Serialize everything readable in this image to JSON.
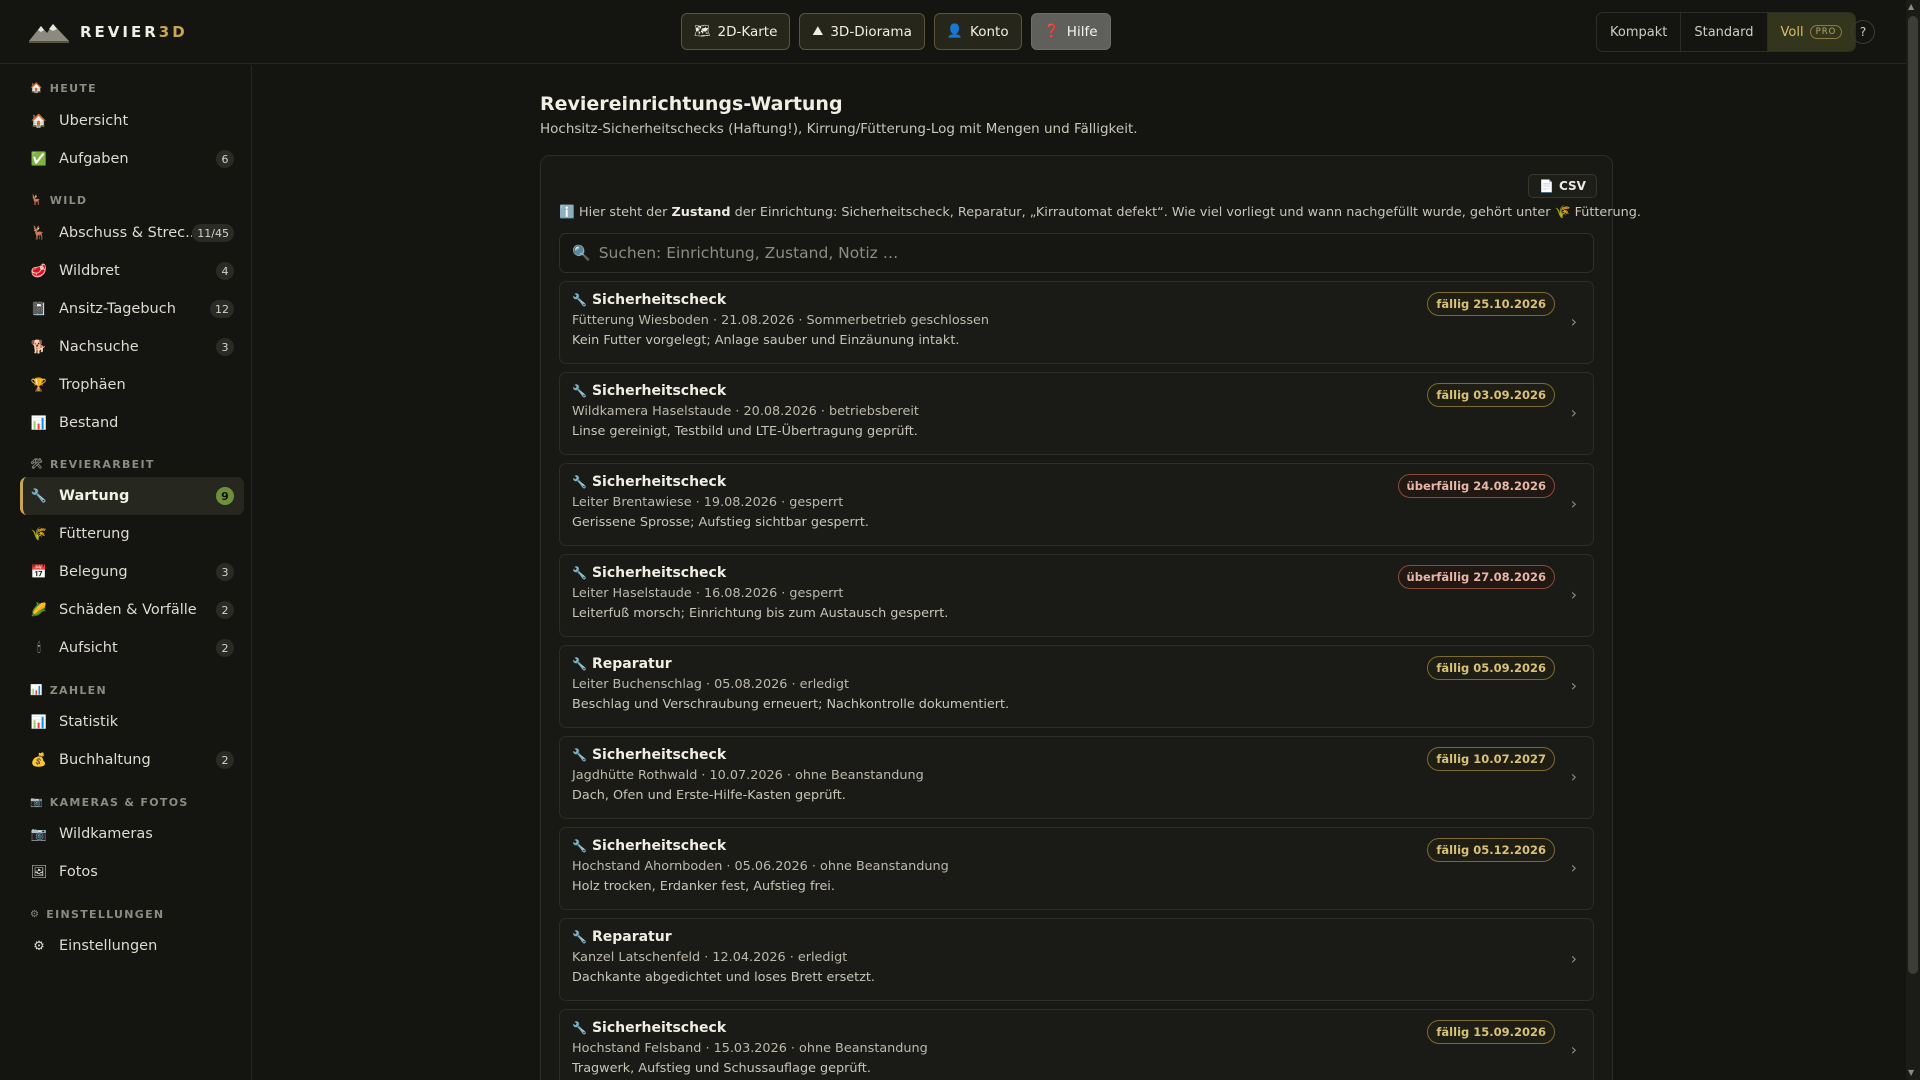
{
  "app": {
    "name_main": "REVIER",
    "name_accent": "3D"
  },
  "nav": {
    "map2d": {
      "icon": "🗺",
      "label": "2D-Karte"
    },
    "diorama3d": {
      "icon": "⛰",
      "label": "3D-Diorama"
    },
    "account": {
      "icon": "👤",
      "label": "Konto"
    },
    "help": {
      "icon": "❓",
      "label": "Hilfe"
    }
  },
  "density": {
    "compact": "Kompakt",
    "standard": "Standard",
    "full": "Voll",
    "pro": "PRO",
    "selected": "Voll"
  },
  "help_short": "?",
  "sidebar": {
    "sections": [
      {
        "icon": "🏠",
        "title": "HEUTE"
      },
      {
        "icon": "🦌",
        "title": "WILD"
      },
      {
        "icon": "🛠",
        "title": "REVIERARBEIT"
      },
      {
        "icon": "📊",
        "title": "ZAHLEN"
      },
      {
        "icon": "📷",
        "title": "KAMERAS & FOTOS"
      },
      {
        "icon": "⚙",
        "title": "EINSTELLUNGEN"
      }
    ],
    "items": [
      {
        "icon": "🏠",
        "label": "Übersicht",
        "badge": ""
      },
      {
        "icon": "✅",
        "label": "Aufgaben",
        "badge": "6"
      },
      {
        "icon": "🦌",
        "label": "Abschuss & Strec...",
        "badge": "11/45"
      },
      {
        "icon": "🥩",
        "label": "Wildbret",
        "badge": "4"
      },
      {
        "icon": "📓",
        "label": "Ansitz-Tagebuch",
        "badge": "12"
      },
      {
        "icon": "🐕",
        "label": "Nachsuche",
        "badge": "3"
      },
      {
        "icon": "🏆",
        "label": "Trophäen",
        "badge": ""
      },
      {
        "icon": "📊",
        "label": "Bestand",
        "badge": ""
      },
      {
        "icon": "🔧",
        "label": "Wartung",
        "badge": "9"
      },
      {
        "icon": "🌾",
        "label": "Fütterung",
        "badge": ""
      },
      {
        "icon": "📅",
        "label": "Belegung",
        "badge": "3"
      },
      {
        "icon": "🌽",
        "label": "Schäden & Vorfälle",
        "badge": "2"
      },
      {
        "icon": "🕯",
        "label": "Aufsicht",
        "badge": "2"
      },
      {
        "icon": "📊",
        "label": "Statistik",
        "badge": ""
      },
      {
        "icon": "💰",
        "label": "Buchhaltung",
        "badge": "2"
      },
      {
        "icon": "📷",
        "label": "Wildkameras",
        "badge": ""
      },
      {
        "icon": "🖼",
        "label": "Fotos",
        "badge": ""
      },
      {
        "icon": "⚙",
        "label": "Einstellungen",
        "badge": ""
      }
    ],
    "active_item": "Wartung"
  },
  "main": {
    "title": "Reviereinrichtungs-Wartung",
    "subtitle": "Hochsitz-Sicherheitschecks (Haftung!), Kirrung/Fütterung-Log mit Mengen und Fälligkeit.",
    "csv_label": "CSV",
    "info": {
      "icon": "ℹ️",
      "pre": "Hier steht der ",
      "bold": "Zustand",
      "post": " der Einrichtung: Sicherheitscheck, Reparatur, „Kirrautomat defekt“. Wie viel vorliegt und wann nachgefüllt wurde, gehört unter 🌾 Fütterung."
    },
    "search_placeholder": "Suchen: Einrichtung, Zustand, Notiz …",
    "entries": [
      {
        "title": "Sicherheitscheck",
        "meta": "Fütterung Wiesboden · 21.08.2026 · Sommerbetrieb geschlossen",
        "note": "Kein Futter vorgelegt; Anlage sauber und Einzäunung intakt.",
        "due": "fällig 25.10.2026",
        "overdue": false
      },
      {
        "title": "Sicherheitscheck",
        "meta": "Wildkamera Haselstaude · 20.08.2026 · betriebsbereit",
        "note": "Linse gereinigt, Testbild und LTE-Übertragung geprüft.",
        "due": "fällig 03.09.2026",
        "overdue": false
      },
      {
        "title": "Sicherheitscheck",
        "meta": "Leiter Brentawiese · 19.08.2026 · gesperrt",
        "note": "Gerissene Sprosse; Aufstieg sichtbar gesperrt.",
        "due": "überfällig 24.08.2026",
        "overdue": true
      },
      {
        "title": "Sicherheitscheck",
        "meta": "Leiter Haselstaude · 16.08.2026 · gesperrt",
        "note": "Leiterfuß morsch; Einrichtung bis zum Austausch gesperrt.",
        "due": "überfällig 27.08.2026",
        "overdue": true
      },
      {
        "title": "Reparatur",
        "meta": "Leiter Buchenschlag · 05.08.2026 · erledigt",
        "note": "Beschlag und Verschraubung erneuert; Nachkontrolle dokumentiert.",
        "due": "fällig 05.09.2026",
        "overdue": false
      },
      {
        "title": "Sicherheitscheck",
        "meta": "Jagdhütte Rothwald · 10.07.2026 · ohne Beanstandung",
        "note": "Dach, Ofen und Erste-Hilfe-Kasten geprüft.",
        "due": "fällig 10.07.2027",
        "overdue": false
      },
      {
        "title": "Sicherheitscheck",
        "meta": "Hochstand Ahornboden · 05.06.2026 · ohne Beanstandung",
        "note": "Holz trocken, Erdanker fest, Aufstieg frei.",
        "due": "fällig 05.12.2026",
        "overdue": false
      },
      {
        "title": "Reparatur",
        "meta": "Kanzel Latschenfeld · 12.04.2026 · erledigt",
        "note": "Dachkante abgedichtet und loses Brett ersetzt.",
        "due": "",
        "overdue": false
      },
      {
        "title": "Sicherheitscheck",
        "meta": "Hochstand Felsband · 15.03.2026 · ohne Beanstandung",
        "note": "Tragwerk, Aufstieg und Schussauflage geprüft.",
        "due": "fällig 15.09.2026",
        "overdue": false
      }
    ]
  },
  "colors": {
    "accent": "#c8a652",
    "background": "#141511",
    "active_badge": "#6f8f3c",
    "overdue": "#8a4c3a"
  }
}
